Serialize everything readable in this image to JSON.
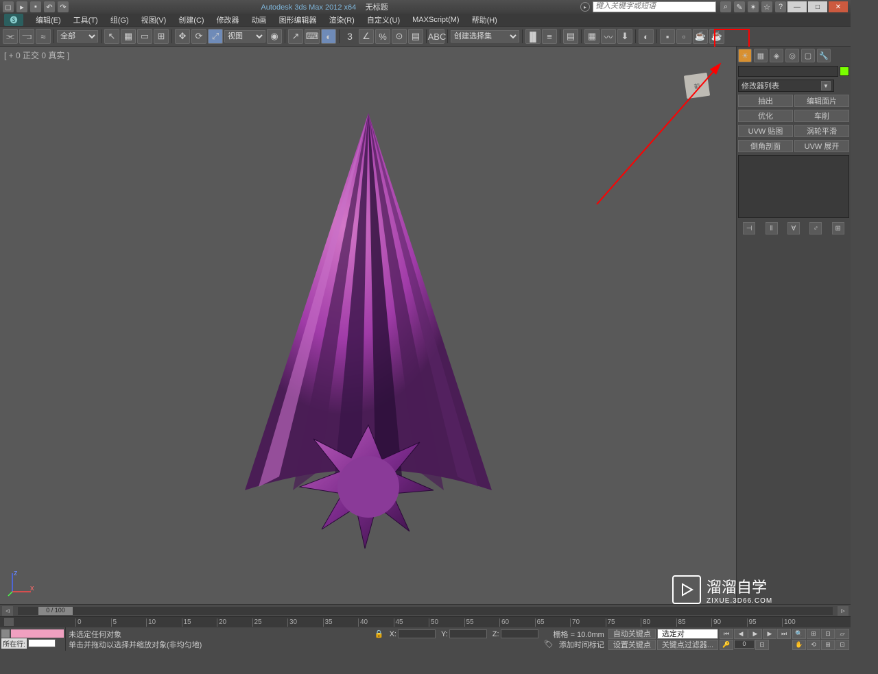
{
  "title_bar": {
    "app_title": "Autodesk 3ds Max 2012 x64",
    "doc_title": "无标题",
    "search_placeholder": "键入关键字或短语"
  },
  "menu": {
    "items": [
      "编辑(E)",
      "工具(T)",
      "组(G)",
      "视图(V)",
      "创建(C)",
      "修改器",
      "动画",
      "图形编辑器",
      "渲染(R)",
      "自定义(U)",
      "MAXScript(M)",
      "帮助(H)"
    ]
  },
  "toolbar": {
    "selection_filter": "全部",
    "viewport_type": "视图",
    "named_set": "创建选择集",
    "axis_label": "3",
    "x_icon": "X"
  },
  "viewport": {
    "label": "[ + 0 正交 0 真实 ]",
    "cube_face": "前"
  },
  "side_panel": {
    "modifier_list": "修改器列表",
    "buttons": [
      [
        "抽出",
        "编辑面片"
      ],
      [
        "优化",
        "车削"
      ],
      [
        "UVW 贴图",
        "涡轮平滑"
      ],
      [
        "倒角剖面",
        "UVW 展开"
      ]
    ]
  },
  "timeline": {
    "pos_label": "0 / 100",
    "ticks": [
      "0",
      "5",
      "10",
      "15",
      "20",
      "25",
      "30",
      "35",
      "40",
      "45",
      "50",
      "55",
      "60",
      "65",
      "70",
      "75",
      "80",
      "85",
      "90",
      "95",
      "100"
    ]
  },
  "status": {
    "current_line_label": "所在行:",
    "no_selection": "未选定任何对象",
    "hint": "单击并拖动以选择并缩放对象(非均匀地)",
    "grid_text": "栅格 = 10.0mm",
    "x_label": "X:",
    "y_label": "Y:",
    "z_label": "Z:",
    "autokey": "自动关键点",
    "selected": "选定对",
    "setkey": "设置关键点",
    "keyfilter": "关键点过滤器...",
    "frame_val": "0",
    "addtag": "添加时间标记"
  },
  "watermark": {
    "main": "溜溜自学",
    "sub": "ZIXUE.3D66.COM"
  }
}
